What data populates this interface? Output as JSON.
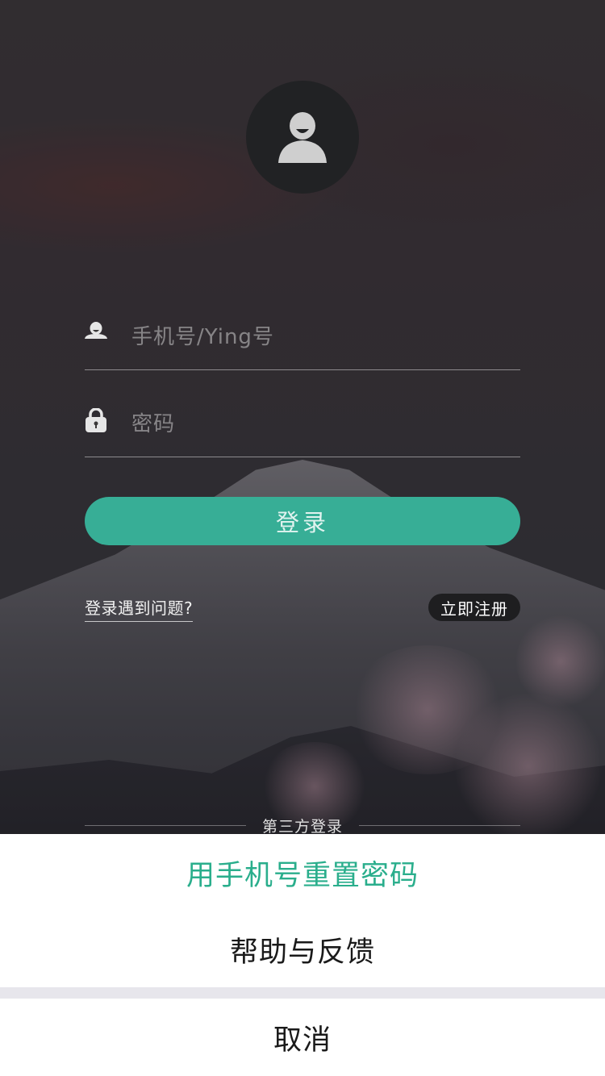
{
  "login_form": {
    "username_placeholder": "手机号/Ying号",
    "password_placeholder": "密码",
    "login_button": "登录",
    "trouble_link": "登录遇到问题?",
    "register_button": "立即注册",
    "third_party_label": "第三方登录"
  },
  "action_sheet": {
    "reset_password": "用手机号重置密码",
    "help_feedback": "帮助与反馈",
    "cancel": "取消"
  },
  "colors": {
    "accent": "#37ae96",
    "sheet_accent_text": "#2aae8c",
    "sheet_text": "#1a1a1a"
  },
  "icons": {
    "avatar": "user-avatar-icon",
    "username": "user-icon",
    "password": "lock-icon"
  }
}
